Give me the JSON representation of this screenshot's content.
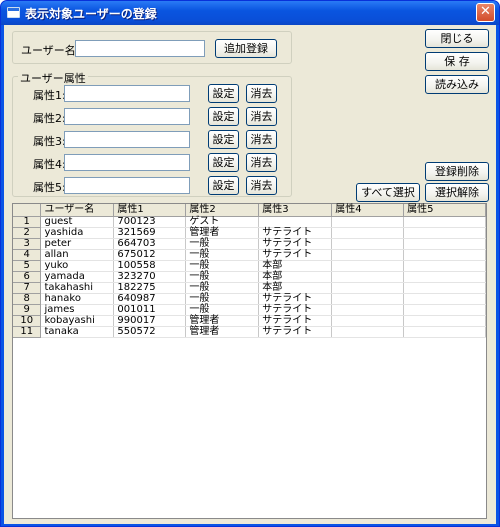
{
  "window": {
    "title": "表示対象ユーザーの登録",
    "close_label": "✕"
  },
  "form": {
    "username_label": "ユーザー名:",
    "username_value": "",
    "add_button": "追加登録",
    "attributes_group": "ユーザー属性",
    "attributes": [
      {
        "label": "属性1:",
        "value": "",
        "set": "設定",
        "clear": "消去"
      },
      {
        "label": "属性2:",
        "value": "",
        "set": "設定",
        "clear": "消去"
      },
      {
        "label": "属性3:",
        "value": "",
        "set": "設定",
        "clear": "消去"
      },
      {
        "label": "属性4:",
        "value": "",
        "set": "設定",
        "clear": "消去"
      },
      {
        "label": "属性5:",
        "value": "",
        "set": "設定",
        "clear": "消去"
      }
    ]
  },
  "side_buttons": {
    "close": "閉じる",
    "save": "保 存",
    "load": "読み込み",
    "delete": "登録削除",
    "select_all": "すべて選択",
    "deselect": "選択解除"
  },
  "grid": {
    "columns": [
      "",
      "ユーザー名",
      "属性1",
      "属性2",
      "属性3",
      "属性4",
      "属性5"
    ],
    "rows": [
      [
        "1",
        "guest",
        "700123",
        "ゲスト",
        "",
        "",
        ""
      ],
      [
        "2",
        "yashida",
        "321569",
        "管理者",
        "サテライト",
        "",
        ""
      ],
      [
        "3",
        "peter",
        "664703",
        "一般",
        "サテライト",
        "",
        ""
      ],
      [
        "4",
        "allan",
        "675012",
        "一般",
        "サテライト",
        "",
        ""
      ],
      [
        "5",
        "yuko",
        "100558",
        "一般",
        "本部",
        "",
        ""
      ],
      [
        "6",
        "yamada",
        "323270",
        "一般",
        "本部",
        "",
        ""
      ],
      [
        "7",
        "takahashi",
        "182275",
        "一般",
        "本部",
        "",
        ""
      ],
      [
        "8",
        "hanako",
        "640987",
        "一般",
        "サテライト",
        "",
        ""
      ],
      [
        "9",
        "james",
        "001011",
        "一般",
        "サテライト",
        "",
        ""
      ],
      [
        "10",
        "kobayashi",
        "990017",
        "管理者",
        "サテライト",
        "",
        ""
      ],
      [
        "11",
        "tanaka",
        "550572",
        "管理者",
        "サテライト",
        "",
        ""
      ]
    ]
  }
}
